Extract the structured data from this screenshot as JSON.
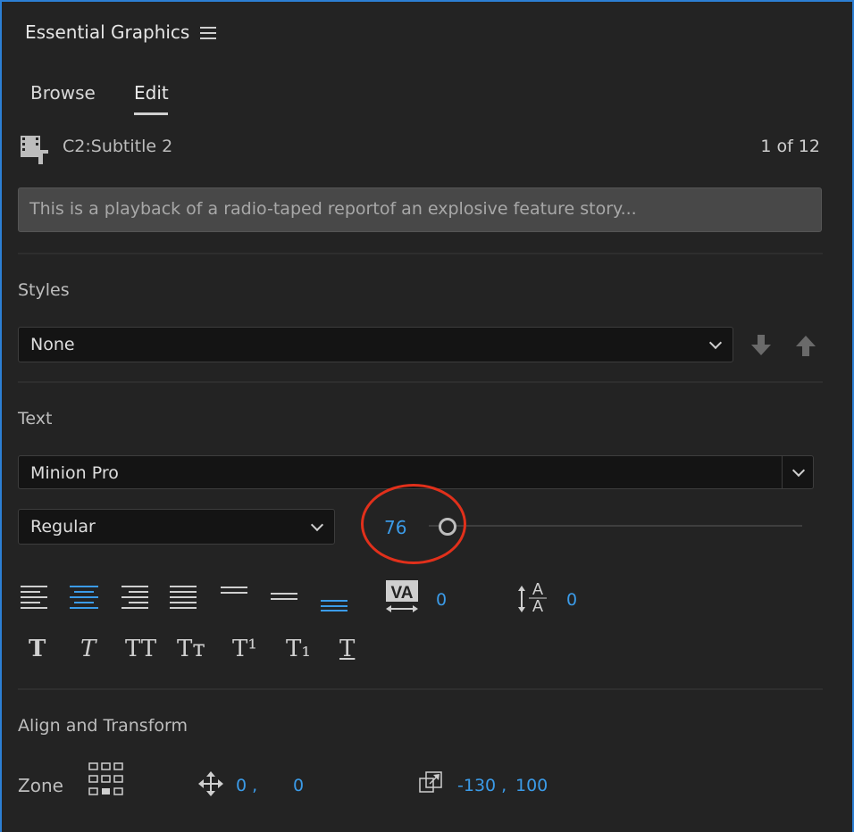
{
  "panel": {
    "title": "Essential Graphics",
    "menu_icon": "hamburger-menu-icon",
    "border_color": "#2c7fd4"
  },
  "tabs": [
    {
      "label": "Browse",
      "active": false
    },
    {
      "label": "Edit",
      "active": true
    }
  ],
  "clip": {
    "icon": "caption-clip-icon",
    "name": "C2:Subtitle 2",
    "counter": "1 of 12"
  },
  "caption_text": {
    "value": "This is a playback of a radio-taped reportof an explosive feature story..."
  },
  "styles": {
    "label": "Styles",
    "selected": "None",
    "push_down_icon": "arrow-down-icon",
    "push_up_icon": "arrow-up-icon"
  },
  "text": {
    "label": "Text",
    "font_family": "Minion Pro",
    "font_style": "Regular",
    "font_size": "76",
    "font_size_fraction": 0.04,
    "highlight_color": "#e1301b",
    "accent_color": "#3b9be8",
    "kerning_value": "0",
    "leading_value": "0",
    "align_buttons": [
      {
        "icon": "align-left-icon",
        "active": false
      },
      {
        "icon": "align-center-icon",
        "active": true
      },
      {
        "icon": "align-right-icon",
        "active": false
      },
      {
        "icon": "justify-icon",
        "active": false
      },
      {
        "icon": "align-top-icon",
        "active": false
      },
      {
        "icon": "align-middle-icon",
        "active": false
      },
      {
        "icon": "align-bottom-icon",
        "active": true
      }
    ],
    "style_buttons": [
      {
        "glyph": "T",
        "icon": "faux-bold-icon"
      },
      {
        "glyph": "T",
        "icon": "faux-italic-icon"
      },
      {
        "glyph": "TT",
        "icon": "all-caps-icon"
      },
      {
        "glyph": "Tт",
        "icon": "small-caps-icon"
      },
      {
        "glyph": "T¹",
        "icon": "superscript-icon"
      },
      {
        "glyph": "T₁",
        "icon": "subscript-icon"
      },
      {
        "glyph": "T",
        "icon": "underline-icon"
      }
    ]
  },
  "align_transform": {
    "label": "Align and Transform",
    "zone_label": "Zone",
    "position_x": "0 ,",
    "position_y": "0",
    "scale_x": "-130 ,",
    "scale_y": "100"
  }
}
